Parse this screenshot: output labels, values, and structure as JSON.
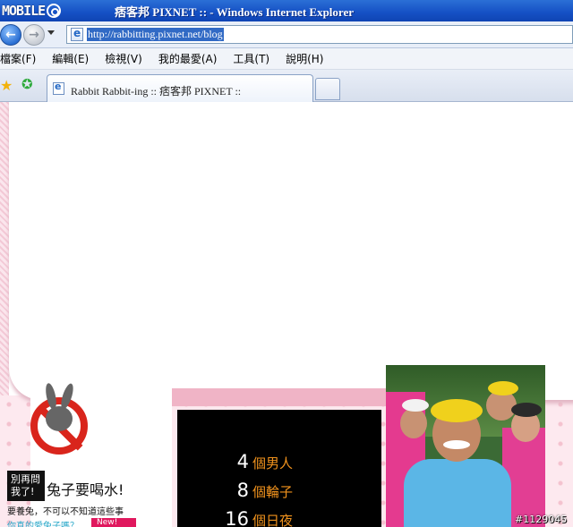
{
  "window": {
    "logo_text": "MOBILE",
    "title": "痞客邦 PIXNET :: - Windows Internet Explorer"
  },
  "address_bar": {
    "url": "http://rabbitting.pixnet.net/blog"
  },
  "menu": [
    "檔案(F)",
    "編輯(E)",
    "檢視(V)",
    "我的最愛(A)",
    "工具(T)",
    "說明(H)"
  ],
  "tabs": [
    {
      "label": "Rabbit Rabbit-ing :: 痞客邦 PIXNET ::",
      "active": true
    }
  ],
  "page": {
    "tag_line1": "別再問",
    "tag_line2": "我了!",
    "slogan": "兔子要喝水!",
    "sub_text": "要養兔，不可以不知道這些事",
    "sub_link": "你真的愛兔子嗎？",
    "new_badge": "New!",
    "stats": [
      {
        "num": "4",
        "label": "個男人"
      },
      {
        "num": "8",
        "label": "個輪子"
      },
      {
        "num": "16",
        "label": "個日夜"
      }
    ],
    "watermark": "#1129045"
  },
  "colors": {
    "titlebar": "#1550c4",
    "accent_orange": "#f0921d",
    "no_sign_red": "#d9251c",
    "pink_bg": "#fde9ef"
  },
  "icons": [
    "back-arrow-icon",
    "forward-arrow-icon",
    "page-icon",
    "favorites-star-icon",
    "add-favorite-icon",
    "no-sign-icon",
    "bunny-icon"
  ]
}
